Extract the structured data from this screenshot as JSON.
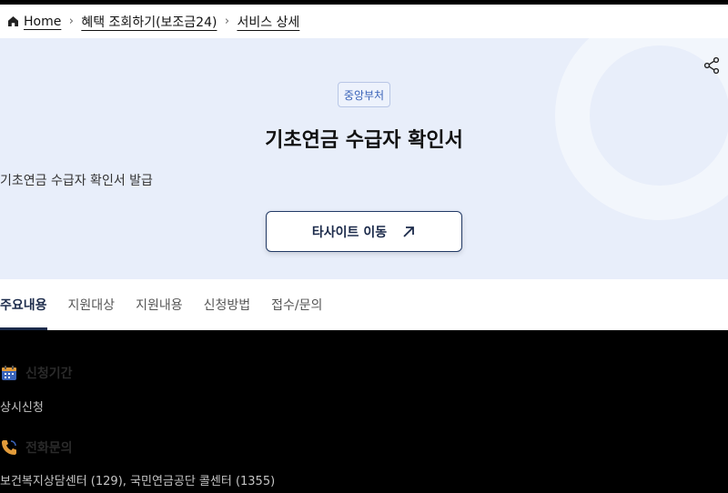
{
  "breadcrumb": {
    "home": "Home",
    "item2": "혜택 조회하기(보조금24)",
    "item3": "서비스 상세"
  },
  "hero": {
    "badge": "중앙부처",
    "title": "기초연금 수급자 확인서",
    "description": "기초연금 수급자 확인서 발급",
    "site_button": "타사이트 이동"
  },
  "tabs": [
    "주요내용",
    "지원대상",
    "지원내용",
    "신청방법",
    "접수/문의"
  ],
  "sections": {
    "period": {
      "heading": "신청기간",
      "value": "상시신청",
      "icon": "calendar-icon"
    },
    "phone": {
      "heading": "전화문의",
      "value": "보건복지상담센터 (129), 국민연금공단 콜센터 (1355)",
      "icon": "phone-icon"
    }
  },
  "colors": {
    "accent": "#1b2a4a",
    "hero_bg": "#e8eefa",
    "badge": "#3a63b8"
  }
}
